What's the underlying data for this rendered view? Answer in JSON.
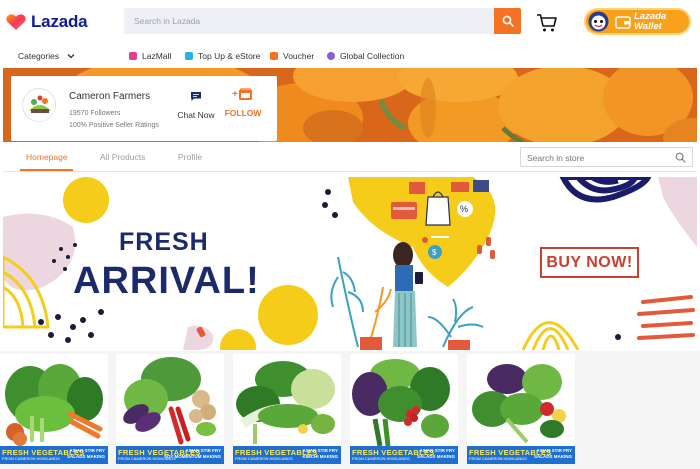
{
  "header": {
    "logo_text": "Lazada",
    "search_placeholder": "Search in Lazada",
    "wallet_line1": "Lazada",
    "wallet_line2": "Wallet"
  },
  "subnav": {
    "categories_label": "Categories",
    "items": [
      {
        "label": "LazMall",
        "color": "#e0418c"
      },
      {
        "label": "Top Up & eStore",
        "color": "#1fb6e3"
      },
      {
        "label": "Voucher",
        "color": "#f57224"
      },
      {
        "label": "Global Collection",
        "color": "#8a5cd6"
      }
    ]
  },
  "store": {
    "name": "Cameron Farmers",
    "followers": "19570 Followers",
    "rating": "100% Positive Seller Ratings",
    "chat_label": "Chat Now",
    "follow_label": "FOLLOW"
  },
  "tabs": [
    {
      "label": "Homepage",
      "active": true
    },
    {
      "label": "All Products",
      "active": false
    },
    {
      "label": "Profile",
      "active": false
    }
  ],
  "store_search_placeholder": "Search in store",
  "promo": {
    "line1": "FRESH",
    "line2": "ARRIVAL!",
    "cta": "BUY NOW!"
  },
  "products": [
    {
      "tag_main": "FRESH VEGETABLES",
      "tag_sub": "FROM CAMERON HIGHLANDS",
      "tag_right1": "ASIAN STIR FRY",
      "tag_right2": "SALADS MAKING"
    },
    {
      "tag_main": "FRESH VEGETABLES",
      "tag_sub": "FROM CAMERON HIGHLANDS",
      "tag_right1": "ASIAN STIR FRY",
      "tag_right2": "SOY MOMENTUM MAKING"
    },
    {
      "tag_main": "FRESH VEGETABLES",
      "tag_sub": "FROM CAMERON HIGHLANDS",
      "tag_right1": "ASIAN STIR FRY",
      "tag_right2": "KIMCHI MAKING"
    },
    {
      "tag_main": "FRESH VEGETABLES",
      "tag_sub": "FROM CAMERON HIGHLANDS",
      "tag_right1": "ASIAN STIR FRY",
      "tag_right2": "SALADS MAKING"
    },
    {
      "tag_main": "FRESH VEGETABLES",
      "tag_sub": "FROM CAMERON HIGHLANDS",
      "tag_right1": "ASIAN STIR FRY",
      "tag_right2": "SALADS MAKING"
    }
  ],
  "colors": {
    "brand_orange": "#f57224",
    "brand_navy": "#101c8f",
    "promo_navy": "#1b2a6b",
    "promo_red": "#c8412f",
    "tag_blue": "#1f6fd1"
  }
}
